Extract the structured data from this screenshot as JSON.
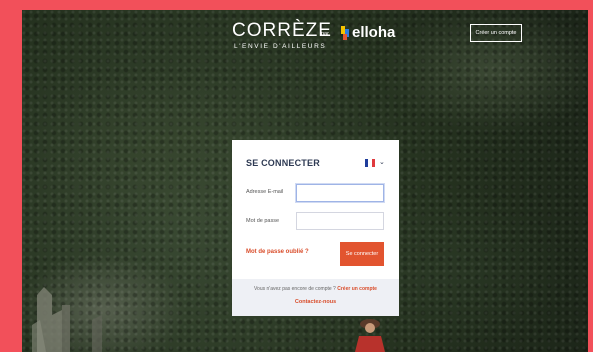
{
  "header": {
    "brand_title": "CORRÈZE",
    "brand_tagline": "L'ENVIE D'AILLEURS",
    "par": "par",
    "partner_name": "elloha",
    "create_account_button": "Créer un compte"
  },
  "login_card": {
    "title": "SE CONNECTER",
    "language": {
      "flag": "fr-flag",
      "chevron": "⌄"
    },
    "email_label": "Adresse E-mail",
    "email_value": "",
    "password_label": "Mot de passe",
    "password_value": "",
    "forgot_password_link": "Mot de passe oublié ?",
    "submit_button": "Se connecter",
    "footer": {
      "no_account_text": "Vous n'avez pas encore de compte ?",
      "create_account_link": "Créer un compte",
      "contact_link": "Contactez-nous"
    }
  },
  "colors": {
    "frame": "#f2505a",
    "accent": "#e2542f",
    "title": "#2e3a53"
  }
}
